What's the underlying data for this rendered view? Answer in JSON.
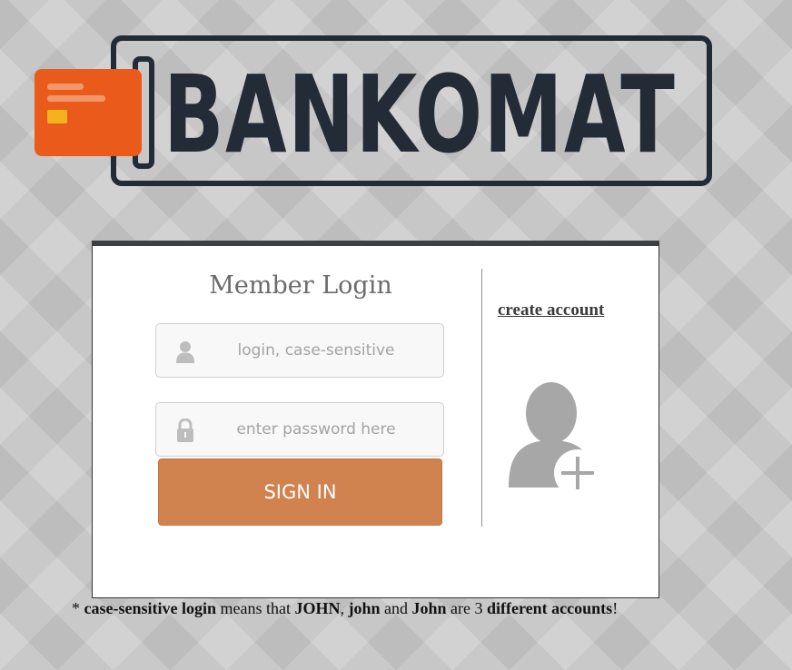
{
  "logo": {
    "text": "BANKOMAT",
    "icon": "credit-card-icon",
    "colors": {
      "dark": "#232b36",
      "card": "#ea5b1b",
      "chip": "#f2b31d"
    }
  },
  "login": {
    "title": "Member Login",
    "username_placeholder": "login, case-sensitive",
    "username_value": "",
    "username_icon": "user-icon",
    "password_placeholder": "enter password here",
    "password_value": "",
    "password_icon": "lock-icon",
    "submit_label": "SIGN IN",
    "accent_color": "#d0834e"
  },
  "register": {
    "link_label": "create account",
    "icon": "add-user-icon"
  },
  "footnote": {
    "p1": "* ",
    "b1": "case-sensitive login",
    "p2": " means that ",
    "b2": "JOHN",
    "p3": ", ",
    "b3": "john",
    "p4": " and ",
    "b4": "John",
    "p5": " are 3 ",
    "b5": "different accounts",
    "p6": "!"
  }
}
